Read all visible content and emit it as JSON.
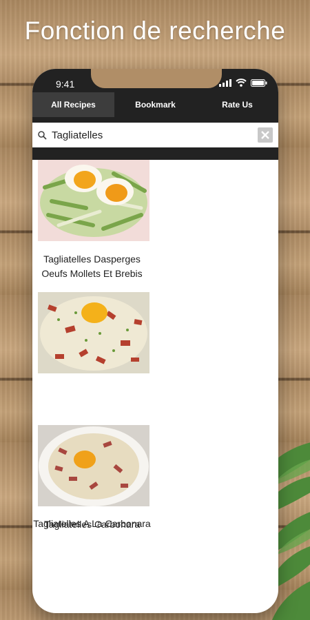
{
  "headline": "Fonction de recherche",
  "status_bar": {
    "time": "9:41"
  },
  "tabs": [
    {
      "label": "All Recipes",
      "active": true
    },
    {
      "label": "Bookmark",
      "active": false
    },
    {
      "label": "Rate Us",
      "active": false
    }
  ],
  "search": {
    "value": "Tagliatelles"
  },
  "results": [
    {
      "title": "Tagliatelles Dasperges Oeufs Mollets Et Brebis",
      "image": "asparagus-egg-pasta"
    },
    {
      "title": "Tagliatelles A La Carbonara",
      "image": "carbonara-pasta"
    },
    {
      "title": "Tagliatelles Carbonara",
      "image": "carbonara-plate"
    }
  ],
  "colors": {
    "header_bg": "#222222",
    "active_tab_bg": "#3d3d3d",
    "background": "#ffffff",
    "accent": "#f2a51c"
  }
}
